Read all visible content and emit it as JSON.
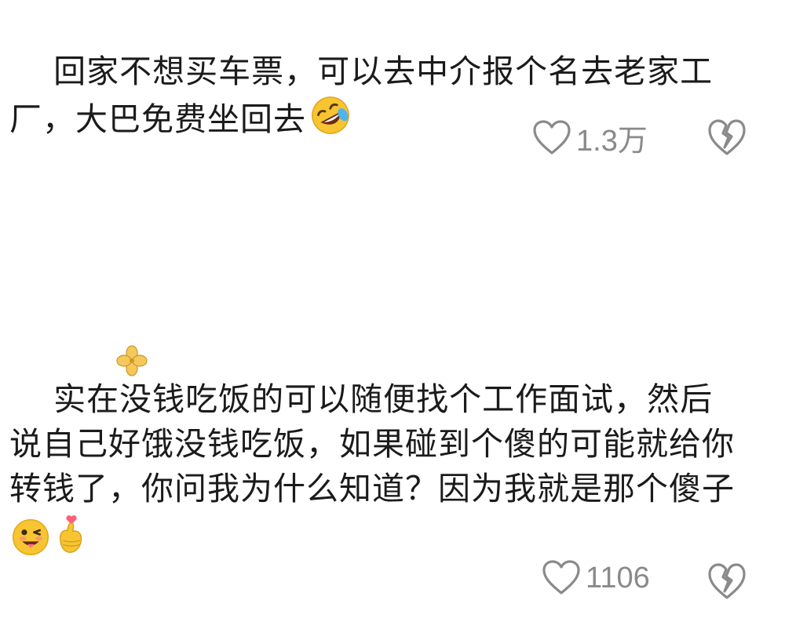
{
  "comments": [
    {
      "text": "回家不想买车票，可以去中介报个名去老家工厂，大巴免费坐回去",
      "emoji": "rolling-on-floor-laughing-emoji",
      "likes": "1.3万"
    },
    {
      "text": "实在没钱吃饭的可以随便找个工作面试，然后说自己好饿没钱吃饭，如果碰到个傻的可能就给你转钱了，你问我为什么知道？因为我就是那个傻子",
      "emoji": [
        "winking-tongue-out-emoji",
        "finger-heart-emoji"
      ],
      "overlay_sticker": "clover-sticker",
      "likes": "1106"
    }
  ],
  "colors": {
    "text": "#1b1b1b",
    "icon": "#8a8a8a",
    "emoji_yellow": "#f7c531"
  }
}
